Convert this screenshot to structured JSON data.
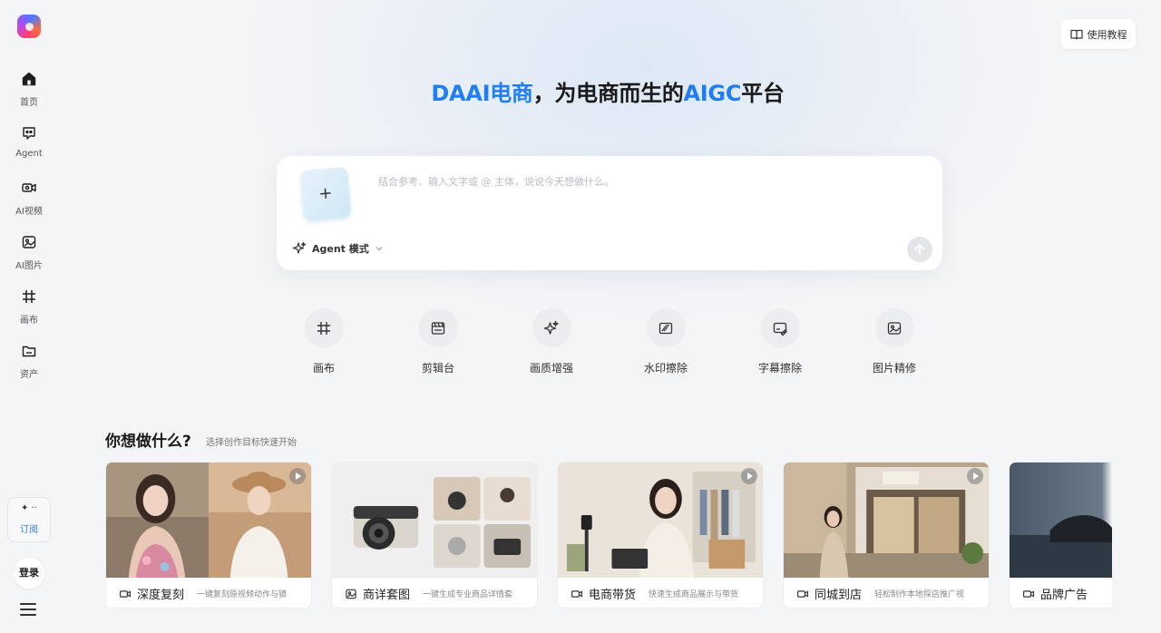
{
  "hero": {
    "title_blue_1": "DAAI电商",
    "title_mid": "，为电商而生的",
    "title_blue_2": "AIGC",
    "title_end": "平台"
  },
  "sidebar": {
    "items": [
      {
        "label": "首页",
        "icon": "home-icon"
      },
      {
        "label": "Agent",
        "icon": "agent-chat-icon"
      },
      {
        "label": "AI视频",
        "icon": "video-camera-icon"
      },
      {
        "label": "AI图片",
        "icon": "image-icon"
      },
      {
        "label": "画布",
        "icon": "grid-canvas-icon"
      },
      {
        "label": "资产",
        "icon": "folder-icon"
      }
    ],
    "subscribe_icon": "✦ ··",
    "subscribe_label": "订阅",
    "login_label": "登录"
  },
  "tutorial": {
    "label": "使用教程"
  },
  "prompt": {
    "placeholder": "结合参考、输入文字或 @ 主体，说说今天想做什么。",
    "upload_label": "+",
    "mode_label": "Agent 模式"
  },
  "tools": [
    {
      "label": "画布",
      "icon": "grid-canvas-icon"
    },
    {
      "label": "剪辑台",
      "icon": "clapperboard-icon"
    },
    {
      "label": "画质增强",
      "icon": "sparkle-icon"
    },
    {
      "label": "水印擦除",
      "icon": "watermark-eraser-icon"
    },
    {
      "label": "字幕擦除",
      "icon": "subtitle-eraser-icon"
    },
    {
      "label": "图片精修",
      "icon": "image-retouch-icon"
    }
  ],
  "section": {
    "title": "你想做什么?",
    "subtitle": "选择创作目标快速开始"
  },
  "cards": [
    {
      "title": "深度复刻",
      "desc": "一键复刻原视频动作与镜",
      "icon": "video-camera-icon"
    },
    {
      "title": "商详套图",
      "desc": "一键生成专业商品详情套",
      "icon": "image-icon"
    },
    {
      "title": "电商带货",
      "desc": "快速生成商品展示与带货",
      "icon": "video-camera-icon"
    },
    {
      "title": "同城到店",
      "desc": "轻松制作本地探店推广视",
      "icon": "video-camera-icon"
    },
    {
      "title": "品牌广告",
      "desc": "",
      "icon": "video-camera-icon"
    }
  ],
  "colors": {
    "accent": "#1f7ef2",
    "background": "#f4f5f7"
  }
}
